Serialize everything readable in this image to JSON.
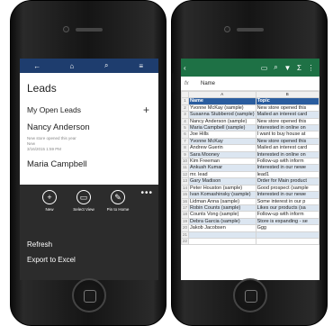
{
  "crm": {
    "title": "Leads",
    "list_label": "My Open Leads",
    "add": "+",
    "record1": {
      "name": "Nancy Anderson",
      "detail1": "New store opened this year",
      "detail2": "New",
      "detail3": "3/16/2015 1:59 PM"
    },
    "record2": {
      "name": "Maria Campbell"
    },
    "more": "•••",
    "actions": [
      {
        "label": "New",
        "icon": "+"
      },
      {
        "label": "Select View",
        "icon": "▭"
      },
      {
        "label": "Pin to Home",
        "icon": "✎"
      }
    ],
    "menu": [
      "Refresh",
      "Export to Excel"
    ]
  },
  "excel": {
    "formula_label": "fx",
    "formula_value": "Name",
    "col_a": "A",
    "col_b": "B",
    "rows": [
      [
        "Name",
        "Topic"
      ],
      [
        "Yvonne McKay (sample)",
        "New store opened this"
      ],
      [
        "Susanna Stubberod (sample)",
        "Mailed an interest card"
      ],
      [
        "Nancy Anderson (sample)",
        "New store opened this"
      ],
      [
        "Maria Campbell (sample)",
        "Interested in online on"
      ],
      [
        "Joe Hills",
        "I want to buy house at"
      ],
      [
        "Yvonne McKay",
        "New store opened this"
      ],
      [
        "Andrew Guerin",
        "Mailed an interest card"
      ],
      [
        "Sara Mooney",
        "Interested in online on"
      ],
      [
        "Kim Freeman",
        "Follow-up with inform"
      ],
      [
        "Ankush Kumar",
        "Interested in our newe"
      ],
      [
        "mr. lead",
        "lead1"
      ],
      [
        "Gary Madison",
        "Order for Main product"
      ],
      [
        "Peter Houston (sample)",
        "Good prospect (sample"
      ],
      [
        "Ivan Komashinsky (sample)",
        "Interested in our newe"
      ],
      [
        "Lidman Anna (sample)",
        "Some interest in our p"
      ],
      [
        "Robin Counts (sample)",
        "Likes our products (sa"
      ],
      [
        "Counts Vong (sample)",
        "Follow-up with inform"
      ],
      [
        "Debra Garcia (sample)",
        "Store is expanding - se"
      ],
      [
        "Jakob Jacobsen",
        "Ggg"
      ],
      [
        "",
        ""
      ],
      [
        "",
        ""
      ]
    ]
  }
}
